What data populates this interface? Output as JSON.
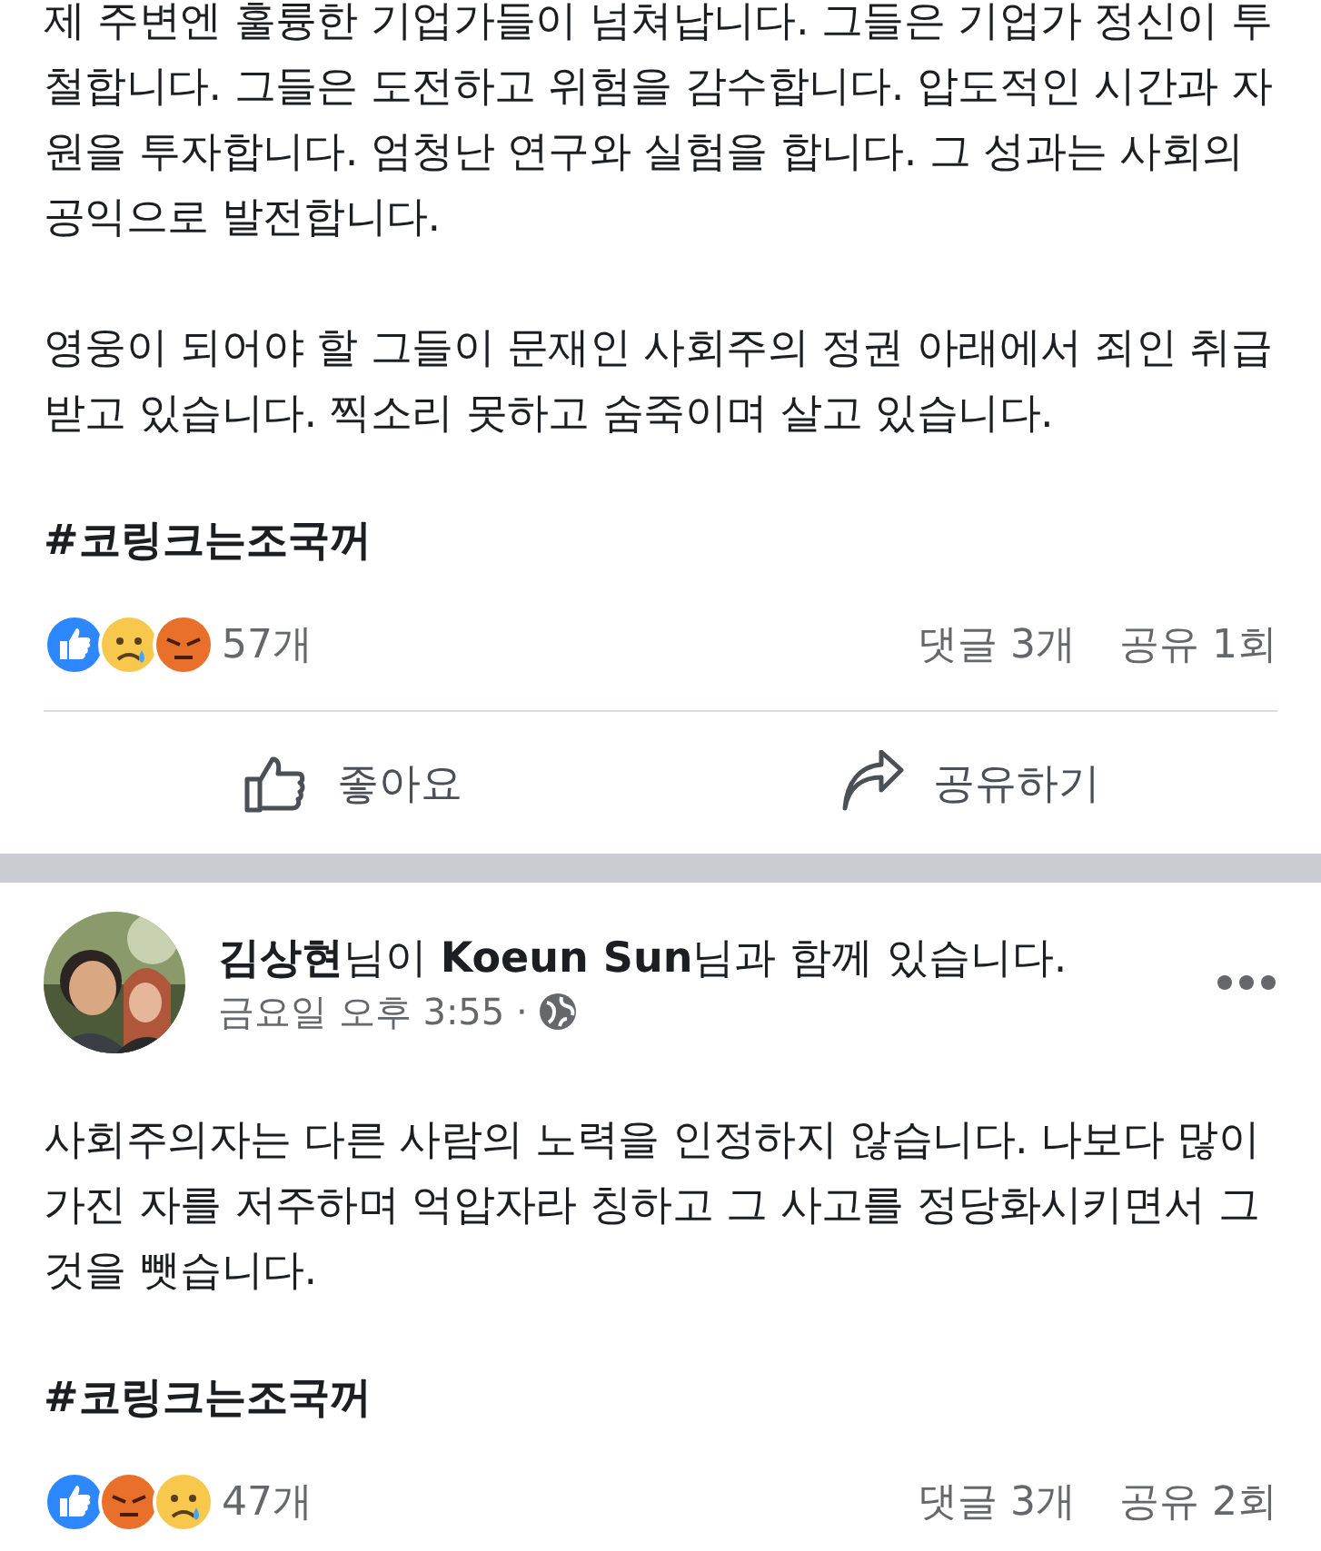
{
  "posts": [
    {
      "paragraphs": [
        "제 주변엔 훌륭한 기업가들이 넘쳐납니다. 그들은 기업가 정신이 투철합니다. 그들은 도전하고 위험을 감수합니다. 압도적인 시간과 자원을 투자합니다. 엄청난 연구와 실험을 합니다. 그 성과는 사회의 공익으로 발전합니다.",
        "영웅이 되어야 할 그들이 문재인 사회주의 정권 아래에서 죄인 취급받고 있습니다. 찍소리 못하고 숨죽이며 살고 있습니다."
      ],
      "hashtag": "#코링크는조국꺼",
      "reactions": [
        {
          "kind": "like"
        },
        {
          "kind": "sad"
        },
        {
          "kind": "angry"
        }
      ],
      "reaction_count": "57개",
      "comments": "댓글 3개",
      "shares": "공유 1회",
      "actions": [
        {
          "kind": "like",
          "label": "좋아요"
        },
        {
          "kind": "share",
          "label": "공유하기"
        }
      ]
    },
    {
      "header": {
        "author": "김상현",
        "author_suffix": "님이 ",
        "tagged": "Koeun Sun",
        "tagged_suffix": "님과 함께 있습니다.",
        "time": "금요일 오후 3:55 ·"
      },
      "paragraphs": [
        "사회주의자는 다른 사람의 노력을 인정하지 않습니다. 나보다 많이 가진 자를 저주하며 억압자라 칭하고 그 사고를 정당화시키면서 그것을 뺏습니다."
      ],
      "hashtag": "#코링크는조국꺼",
      "reactions": [
        {
          "kind": "like"
        },
        {
          "kind": "angry"
        },
        {
          "kind": "sad"
        }
      ],
      "reaction_count": "47개",
      "comments": "댓글 3개",
      "shares": "공유 2회"
    }
  ]
}
